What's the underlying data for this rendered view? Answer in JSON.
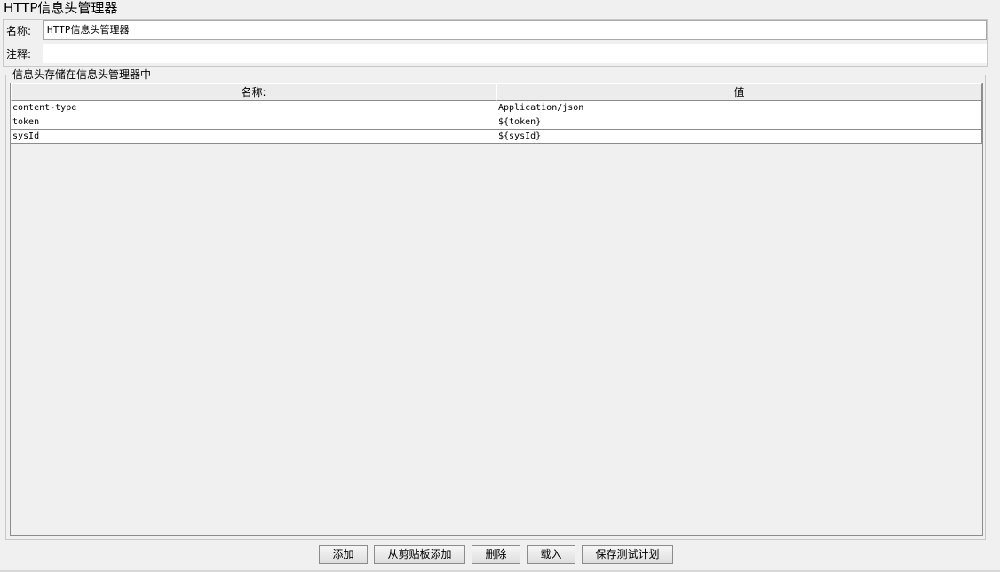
{
  "panel": {
    "title": "HTTP信息头管理器"
  },
  "fields": {
    "name_label": "名称:",
    "name_value": "HTTP信息头管理器",
    "comment_label": "注释:",
    "comment_value": ""
  },
  "group": {
    "legend": "信息头存储在信息头管理器中"
  },
  "table": {
    "columns": [
      "名称:",
      "值"
    ],
    "rows": [
      [
        "content-type",
        "Application/json"
      ],
      [
        "token",
        "${token}"
      ],
      [
        "sysId",
        "${sysId}"
      ]
    ]
  },
  "buttons": {
    "add": "添加",
    "add_from_clipboard": "从剪贴板添加",
    "delete": "删除",
    "load": "载入",
    "save_test_plan": "保存测试计划"
  }
}
